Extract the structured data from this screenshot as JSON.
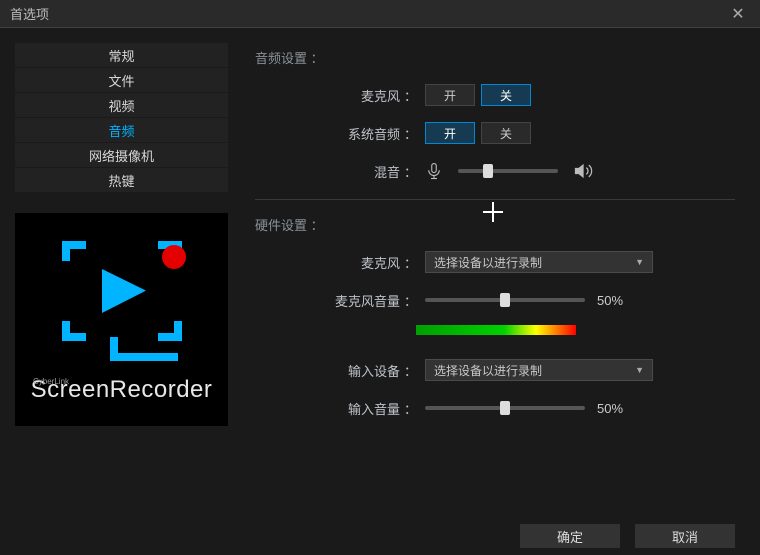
{
  "window": {
    "title": "首选项"
  },
  "sidebar": {
    "items": [
      {
        "label": "常规"
      },
      {
        "label": "文件"
      },
      {
        "label": "视频"
      },
      {
        "label": "音频"
      },
      {
        "label": "网络摄像机"
      },
      {
        "label": "热键"
      }
    ],
    "brand_small": "CyberLink",
    "brand": "ScreenRecorder"
  },
  "audio": {
    "section_title": "音频设置",
    "mic_label": "麦克风",
    "on": "开",
    "off": "关",
    "system_audio_label": "系统音频",
    "mix_label": "混音",
    "mix_value": 30
  },
  "hardware": {
    "section_title": "硬件设置",
    "mic_label": "麦克风",
    "mic_dropdown": "选择设备以进行录制",
    "mic_volume_label": "麦克风音量",
    "mic_volume_pct": "50%",
    "mic_volume_value": 50,
    "input_device_label": "输入设备",
    "input_dropdown": "选择设备以进行录制",
    "input_volume_label": "输入音量",
    "input_volume_pct": "50%",
    "input_volume_value": 50
  },
  "footer": {
    "ok": "确定",
    "cancel": "取消"
  }
}
